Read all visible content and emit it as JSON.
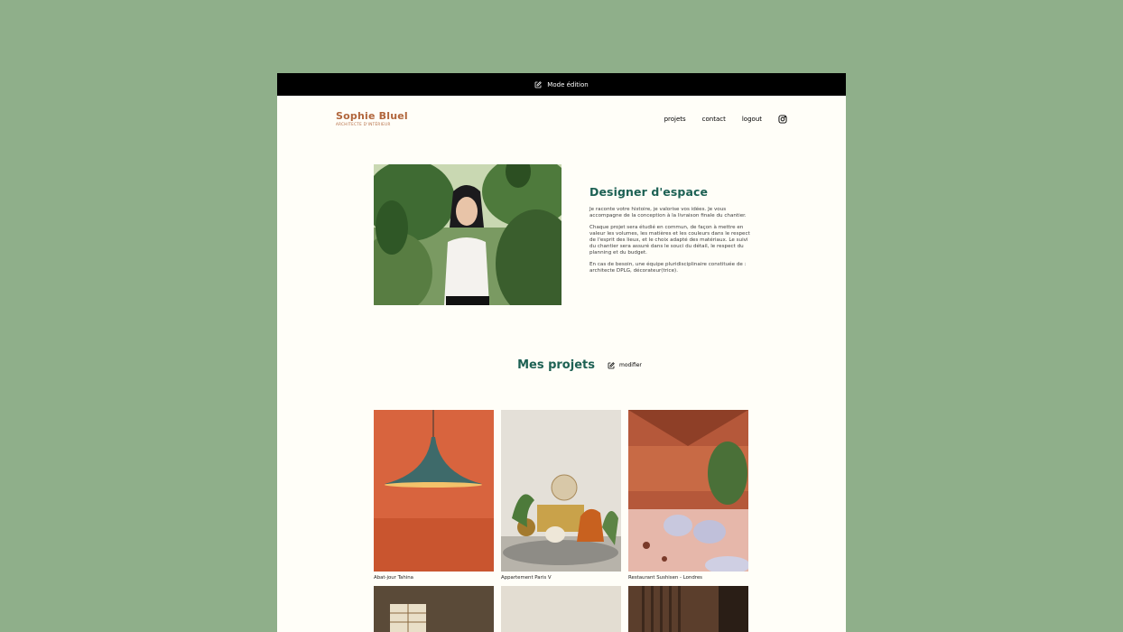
{
  "edit_bar": {
    "label": "Mode édition",
    "icon": "edit-icon"
  },
  "header": {
    "logo_name": "Sophie Bluel",
    "logo_subtitle": "ARCHITECTE D'INTÉRIEUR",
    "nav": [
      "projets",
      "contact",
      "logout"
    ],
    "social_icon": "instagram-icon"
  },
  "intro": {
    "title": "Designer d'espace",
    "paragraphs": [
      "Je raconte votre histoire, je valorise vos idées. Je vous accompagne de la conception à la livraison finale du chantier.",
      "Chaque projet sera étudié en commun, de façon à mettre en valeur les volumes, les matières et les couleurs dans le respect de l'esprit des lieux, et le choix adapté des matériaux. Le suivi du chantier sera assuré dans le souci du détail, le respect du planning et du budget.",
      "En cas de besoin, une équipe pluridisciplinaire constituée de : architecte DPLG, décorateur(trice)."
    ]
  },
  "projects": {
    "title": "Mes projets",
    "modify_label": "modifier",
    "items": [
      {
        "caption": "Abat-jour Tahina"
      },
      {
        "caption": "Appartement Paris V"
      },
      {
        "caption": "Restaurant Sushisen - Londres"
      },
      {
        "caption": ""
      },
      {
        "caption": ""
      },
      {
        "caption": ""
      }
    ]
  },
  "colors": {
    "accent": "#1d6154",
    "brand": "#b1663c",
    "page_bg": "#8faf8a",
    "site_bg": "#fffef8"
  }
}
